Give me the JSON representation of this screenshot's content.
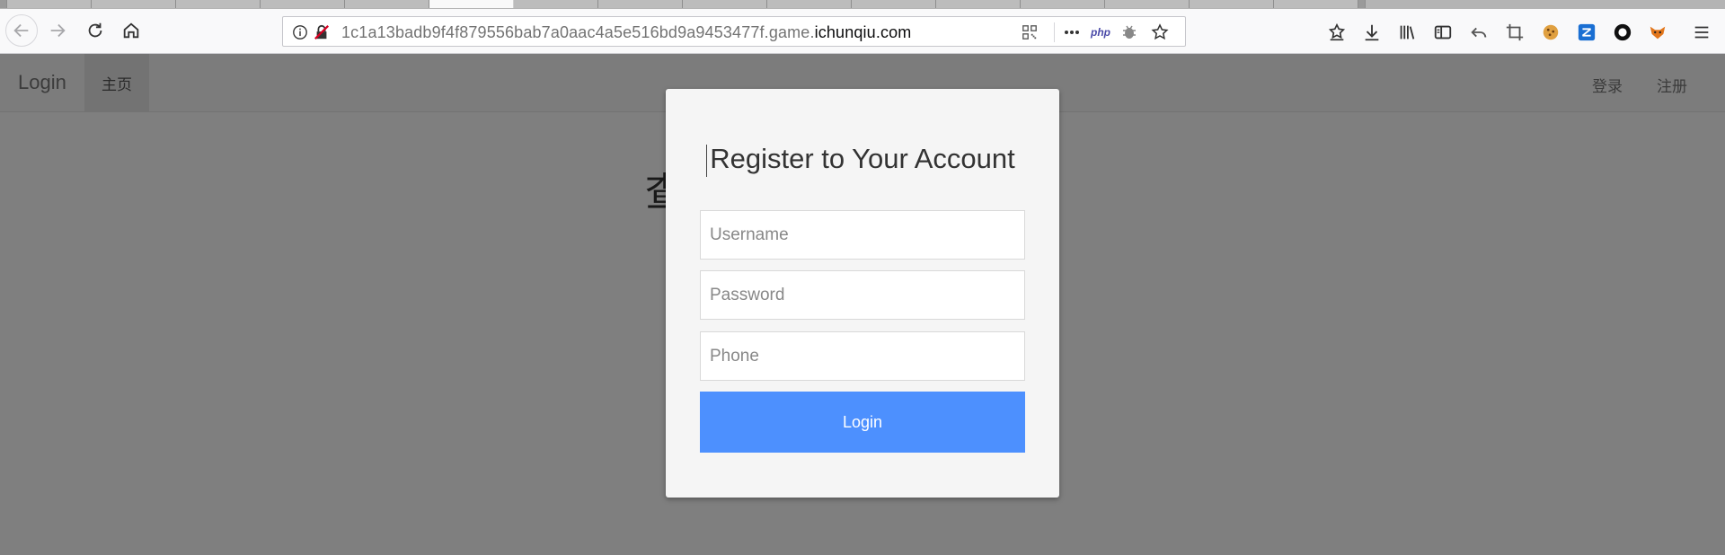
{
  "browser": {
    "url_prefix": "1c1a13badb9f4f879556bab7a0aac4a5e516bd9a9453477f.game.",
    "url_domain": "ichunqiu.com",
    "addon_php_label": "php"
  },
  "navbar": {
    "brand": "Login",
    "home": "主页",
    "login_link": "登录",
    "register_link": "注册"
  },
  "page": {
    "headline": "查                              ?"
  },
  "modal": {
    "title": "Register to Your Account",
    "username_placeholder": "Username",
    "password_placeholder": "Password",
    "phone_placeholder": "Phone",
    "submit_label": "Login"
  },
  "colors": {
    "button": "#4d90fe",
    "overlay": "rgba(0,0,0,0.5)"
  }
}
